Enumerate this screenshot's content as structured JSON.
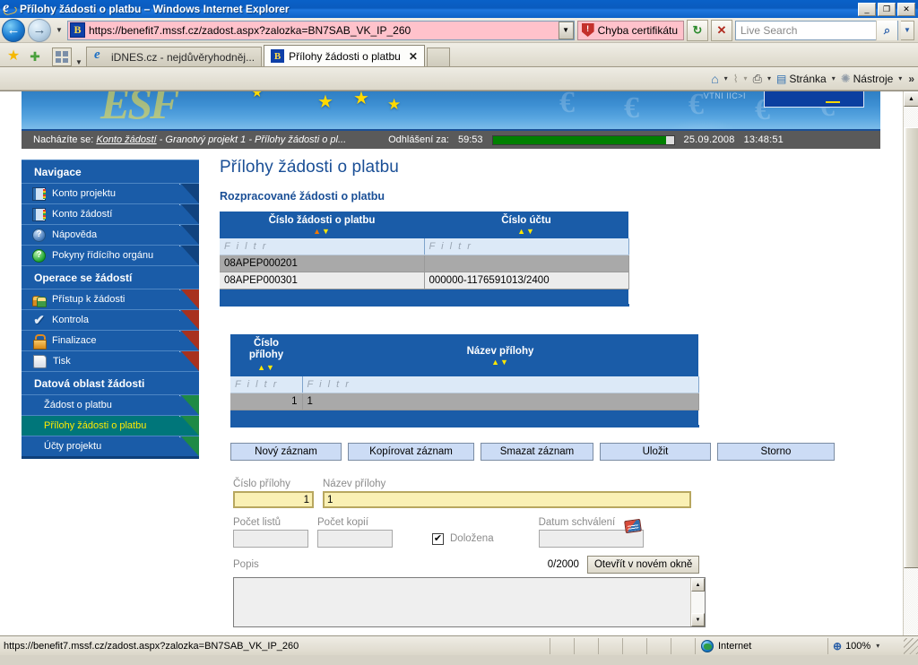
{
  "window": {
    "title": "Přílohy žádosti o platbu – Windows Internet Explorer",
    "minimize": "_",
    "restore": "❐",
    "close": "✕"
  },
  "addressbar": {
    "url": "https://benefit7.mssf.cz/zadost.aspx?zalozka=BN7SAB_VK_IP_260",
    "site_icon_letter": "B",
    "cert_error": "Chyba certifikátu",
    "refresh": "↻",
    "stop": "✕",
    "search_placeholder": "Live Search",
    "search_go": "🔍"
  },
  "tabs": [
    {
      "label": "iDNES.cz - nejdůvěryhodněj...",
      "icon": "ie-icon",
      "active": false
    },
    {
      "label": "Přílohy žádosti o platbu",
      "icon": "benefit-icon",
      "active": true,
      "close": "✕"
    }
  ],
  "commandbar": [
    {
      "label": "",
      "icon": "home-icon"
    },
    {
      "label": "",
      "icon": "feeds-icon"
    },
    {
      "label": "",
      "icon": "print-icon"
    },
    {
      "label": "Stránka",
      "icon": "page-icon"
    },
    {
      "label": "Nástroje",
      "icon": "tools-icon"
    }
  ],
  "commandbar_overflow": "»",
  "banner": {
    "ghost_logo": "ESF",
    "faint_text": "VTNI IIC>I",
    "euro_glyph": "€"
  },
  "breadcrumb": {
    "prefix": "Nacházíte se:",
    "link": "Konto žádostí",
    "trail": " - Granotvý projekt 1 - Přílohy žádosti o pl...",
    "logout_label": "Odhlášení za:",
    "logout_time": "59:53",
    "date": "25.09.2008",
    "time": "13:48:51"
  },
  "sidebar": {
    "sections": [
      {
        "heading": "Navigace",
        "corner": "blue",
        "items": [
          {
            "label": "Konto projektu",
            "icon": "notebook-icon",
            "corner": "blue",
            "active": false
          },
          {
            "label": "Konto žádostí",
            "icon": "notebook-icon",
            "corner": "blue",
            "active": false
          },
          {
            "label": "Nápověda",
            "icon": "question-blue-icon",
            "corner": "blue",
            "active": false
          },
          {
            "label": "Pokyny řídícího orgánu",
            "icon": "question-green-icon",
            "corner": "blue",
            "active": false
          }
        ]
      },
      {
        "heading": "Operace se žádostí",
        "corner": "red",
        "items": [
          {
            "label": "Přístup k žádosti",
            "icon": "users-icon",
            "corner": "red",
            "active": false
          },
          {
            "label": "Kontrola",
            "icon": "check-icon",
            "corner": "red",
            "active": false
          },
          {
            "label": "Finalizace",
            "icon": "lock-icon",
            "corner": "red",
            "active": false
          },
          {
            "label": "Tisk",
            "icon": "document-icon",
            "corner": "red",
            "active": false
          }
        ]
      },
      {
        "heading": "Datová oblast žádosti",
        "corner": "green",
        "items": [
          {
            "label": "Žádost o platbu",
            "icon": "none",
            "corner": "green",
            "active": false
          },
          {
            "label": "Přílohy žádosti o platbu",
            "icon": "none",
            "corner": "green",
            "active": true
          },
          {
            "label": "Účty projektu",
            "icon": "none",
            "corner": "green",
            "active": false
          }
        ]
      }
    ]
  },
  "content": {
    "page_title": "Přílohy žádosti o platbu",
    "section_title": "Rozpracované žádosti o platbu",
    "table_requests": {
      "columns": [
        "Číslo žádosti o platbu",
        "Číslo účtu"
      ],
      "filter_placeholder": "F i l t r",
      "sort_asc": "▲",
      "sort_desc": "▼",
      "rows": [
        {
          "cells": [
            "08APEP000201",
            ""
          ],
          "selected": true
        },
        {
          "cells": [
            "08APEP000301",
            "000000-1176591013/2400"
          ],
          "selected": false
        }
      ]
    },
    "table_attachments": {
      "columns": [
        "Číslo\npřílohy",
        "Název přílohy"
      ],
      "col0_line1": "Číslo",
      "col0_line2": "přílohy",
      "col1": "Název přílohy",
      "filter_placeholder": "F i l t r",
      "rows": [
        {
          "cells": [
            "1",
            "1"
          ],
          "selected": true
        }
      ]
    },
    "buttons": [
      {
        "label": "Nový záznam"
      },
      {
        "label": "Kopírovat záznam"
      },
      {
        "label": "Smazat záznam"
      },
      {
        "label": "Uložit"
      },
      {
        "label": "Storno"
      }
    ],
    "form": {
      "cislo_prilohy_label": "Číslo přílohy",
      "cislo_prilohy_value": "1",
      "nazev_prilohy_label": "Název přílohy",
      "nazev_prilohy_value": "1",
      "pocet_listu_label": "Počet listů",
      "pocet_listu_value": "",
      "pocet_kopii_label": "Počet kopií",
      "pocet_kopii_value": "",
      "dolozena_label": "Doložena",
      "dolozena_checked": "✔",
      "datum_schvaleni_label": "Datum schválení",
      "datum_schvaleni_value": "",
      "popis_label": "Popis",
      "popis_value": "",
      "counter": "0/2000",
      "open_window_button": "Otevřít v novém okně"
    }
  },
  "statusbar": {
    "url": "https://benefit7.mssf.cz/zadost.aspx?zalozka=BN7SAB_VK_IP_260",
    "zone": "Internet",
    "zoom": "100%",
    "zoom_caret": "▾"
  },
  "colors": {
    "brand_blue": "#1a5ca8",
    "header_blue": "#1a4f96",
    "active_teal": "#00767a",
    "active_text": "#ffea00",
    "field_yellow": "#faf0b4",
    "cert_pink": "#ffc2cb",
    "progress_green": "#008000"
  }
}
